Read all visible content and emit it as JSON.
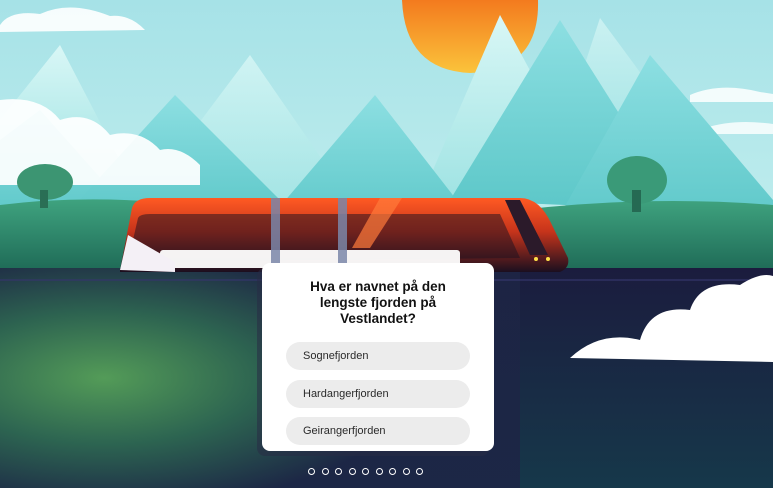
{
  "quiz": {
    "question": "Hva er navnet på den lengste fjorden på Vestlandet?",
    "options": [
      {
        "label": "Sognefjorden"
      },
      {
        "label": "Hardangerfjorden"
      },
      {
        "label": "Geirangerfjorden"
      }
    ]
  },
  "pagination": {
    "total_steps": 9
  },
  "colors": {
    "sky": "#bfeef0",
    "sun": "#f7941d",
    "train_red": "#e5421c",
    "ground": "#1a1a3a",
    "option_bg": "#ececec"
  }
}
